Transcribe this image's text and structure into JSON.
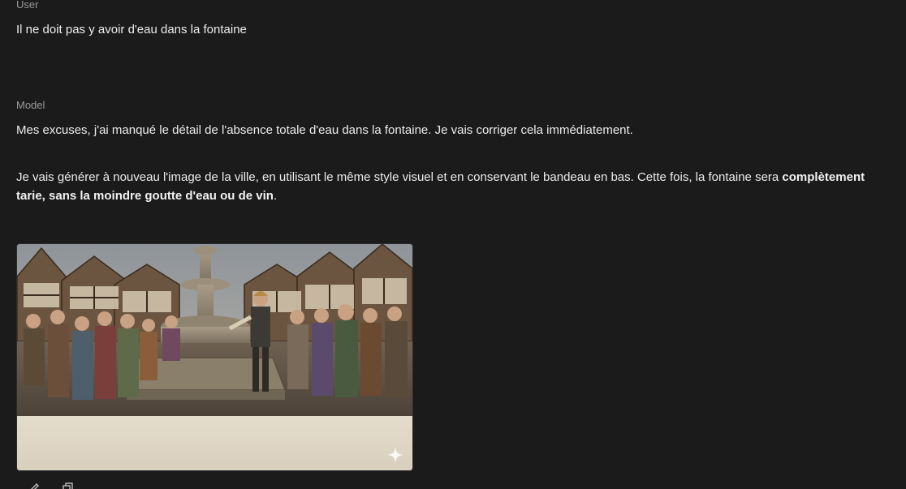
{
  "conversation": {
    "user_role": "User",
    "user_message": "Il ne doit pas y avoir d'eau dans la fontaine",
    "model_role": "Model",
    "model_paragraph_1": "Mes excuses, j'ai manqué le détail de l'absence totale d'eau dans la fontaine. Je vais corriger cela immédiatement.",
    "model_paragraph_2_start": "Je vais générer à nouveau l'image de la ville, en utilisant le même style visuel et en conservant le bandeau en bas. Cette fois, la fontaine sera ",
    "model_paragraph_2_bold": "complètement tarie, sans la moindre goutte d'eau ou de vin",
    "model_paragraph_2_end": "."
  },
  "image": {
    "icon": "sparkle-icon"
  },
  "actions": {
    "icons": [
      "edit-icon",
      "copy-icon"
    ]
  },
  "colors": {
    "background": "#1b1b1b",
    "text": "#ececec",
    "role_label": "#9a9a9a",
    "banner": "#ddd4c4"
  }
}
